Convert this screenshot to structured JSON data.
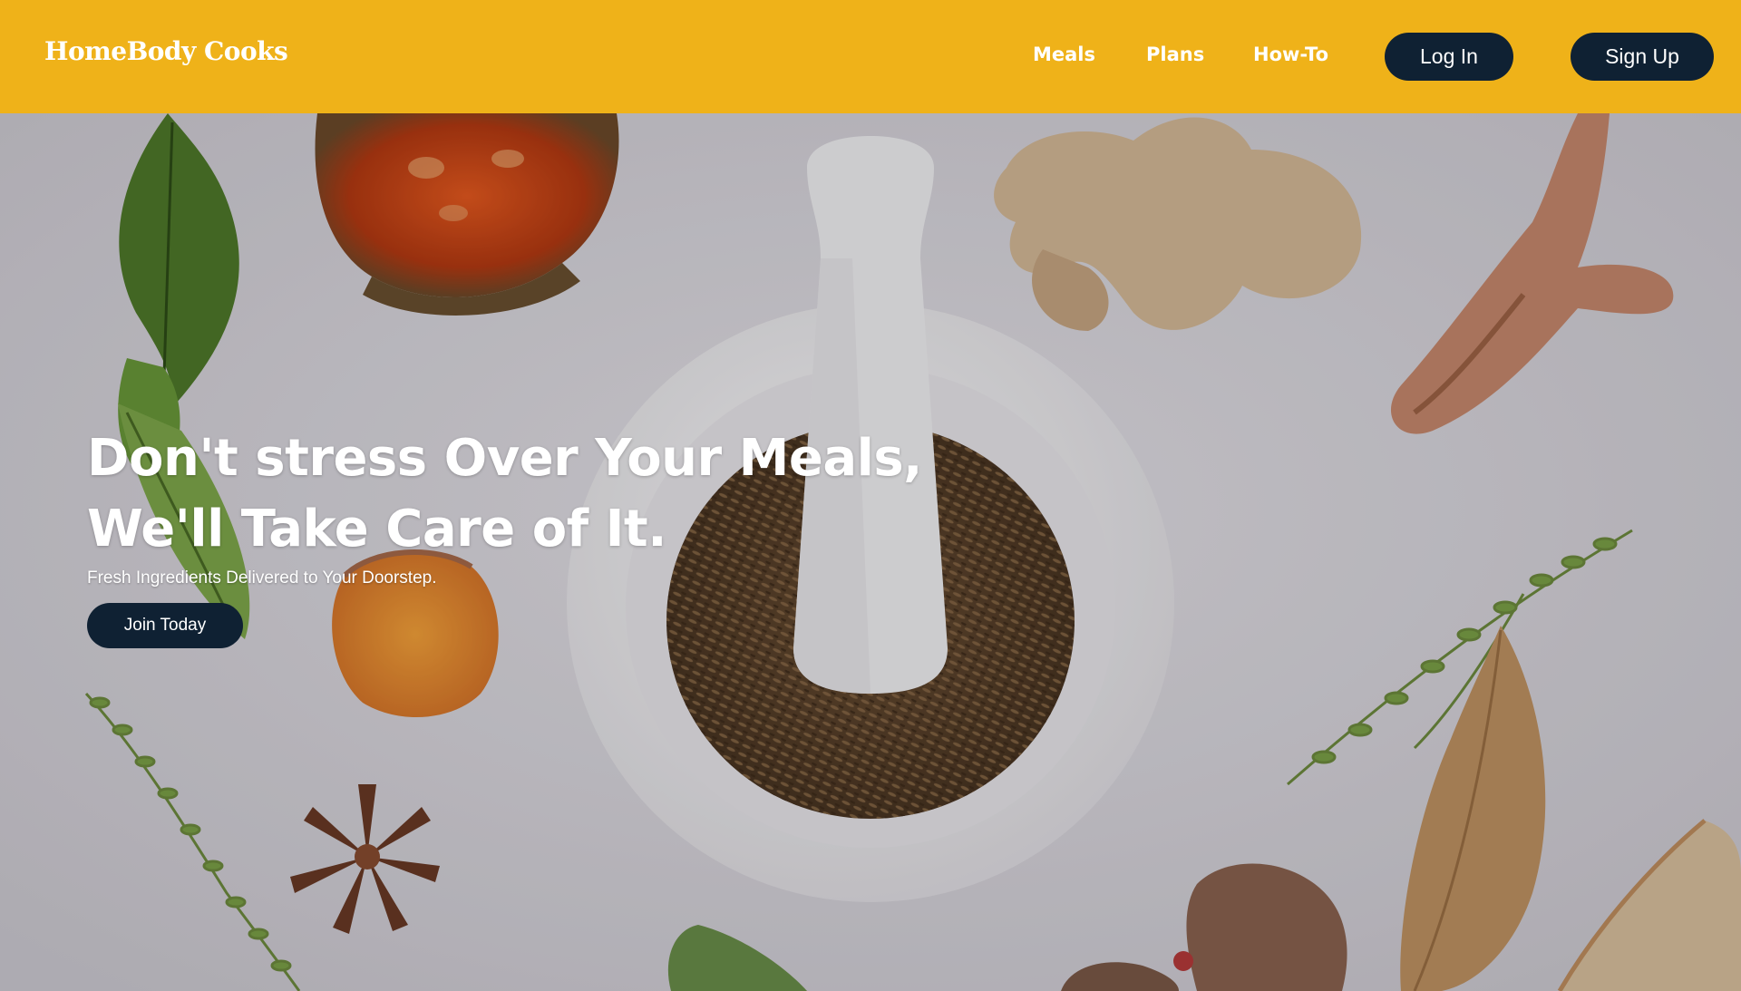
{
  "header": {
    "logo": "HomeBody Cooks",
    "nav": {
      "meals": "Meals",
      "plans": "Plans",
      "howto": "How-To"
    },
    "login_label": "Log In",
    "signup_label": "Sign Up"
  },
  "hero": {
    "title_line1": "Don't stress Over Your Meals,",
    "title_line2": "We'll Take Care of It.",
    "subtitle": "Fresh Ingredients Delivered to Your Doorstep.",
    "cta_label": "Join Today"
  },
  "colors": {
    "header_bg": "#efb219",
    "button_bg": "#0f2133",
    "text_light": "#ffffff"
  }
}
